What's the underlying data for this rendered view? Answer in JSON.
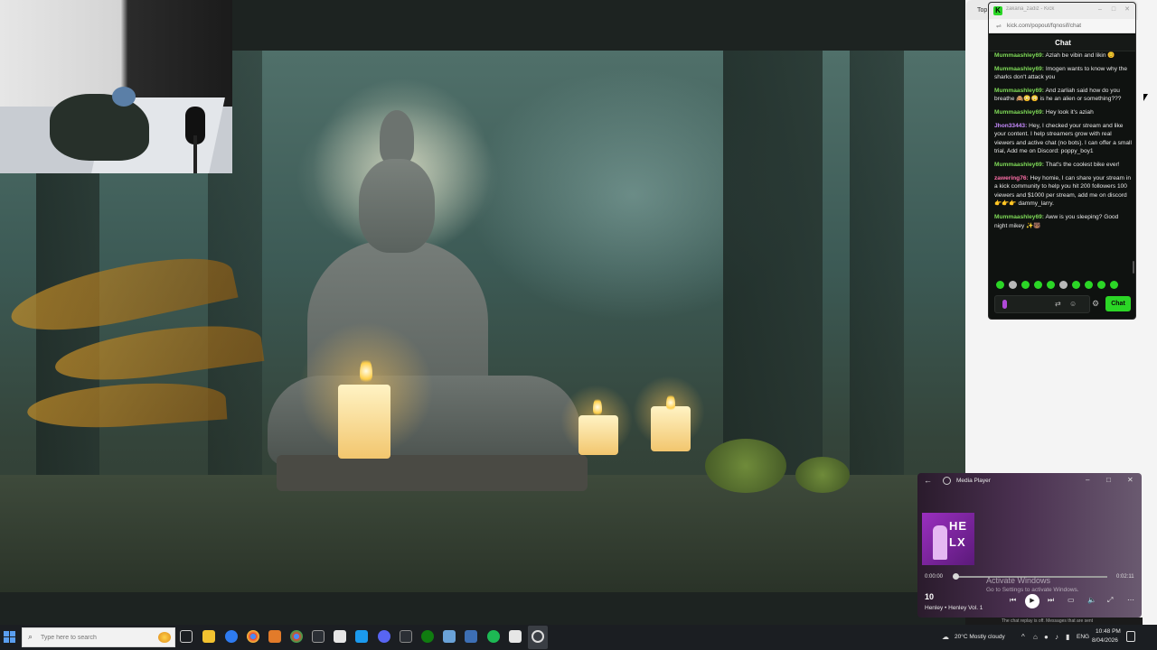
{
  "chat_window": {
    "tab_label": "Top",
    "window_title": "zakaria_zadiz - Kick",
    "url": "kick.com/popout/fqnosif/chat",
    "header": "Chat",
    "messages": [
      {
        "user": "Mummaashley69:",
        "text": "Azlah be vibin and likin 😊",
        "user_color": "#7ed957"
      },
      {
        "user": "Mummaashley69:",
        "text": "Imogen wants to know why the sharks don't attack you",
        "user_color": "#7ed957"
      },
      {
        "user": "Mummaashley69:",
        "text": "And zarliah said how do you breathe 🙈😳😳 is he an alien or something???",
        "user_color": "#7ed957"
      },
      {
        "user": "Mummaashley69:",
        "text": "Hey look it's aziah",
        "user_color": "#7ed957"
      },
      {
        "user": "Jhon33443:",
        "text": "Hey, I checked your stream and like your content. I help streamers grow with real viewers and active chat (no bots). I can offer a small trial, Add me on Discord: poppy_boy1",
        "user_color": "#c78bff"
      },
      {
        "user": "Mummaashley69:",
        "text": "That's the coolest bike ever!",
        "user_color": "#7ed957"
      },
      {
        "user": "zawering76:",
        "text": "Hey homie, I can share your stream in a kick community to help you hit 200 followers 100 viewers and $1000 per stream, add me on discord 👉👉👉 dammy_larry.",
        "user_color": "#ff6fa8"
      },
      {
        "user": "Mummaashley69:",
        "text": "Aww is you sleeping? Good night mikey ✨🐻",
        "user_color": "#7ed957"
      }
    ],
    "send_label": "Chat",
    "accent_color": "#2bd626"
  },
  "media_player": {
    "title": "Media Player",
    "album_art_text": "HE LX",
    "time_elapsed": "0:00:00",
    "time_total": "0:02:11",
    "progress": 0.0,
    "track_number": "10",
    "track_info": "Henley • Henley Vol. 1",
    "overlay_line1": "Activate Windows",
    "overlay_line2": "Go to Settings to activate Windows."
  },
  "under_strip_text": "The chat replay is off. Messages that are sent",
  "taskbar": {
    "search_placeholder": "Type here to search",
    "weather": "20°C  Mostly cloudy",
    "language": "ENG",
    "time": "10:48 PM",
    "date": "8/04/2026"
  }
}
